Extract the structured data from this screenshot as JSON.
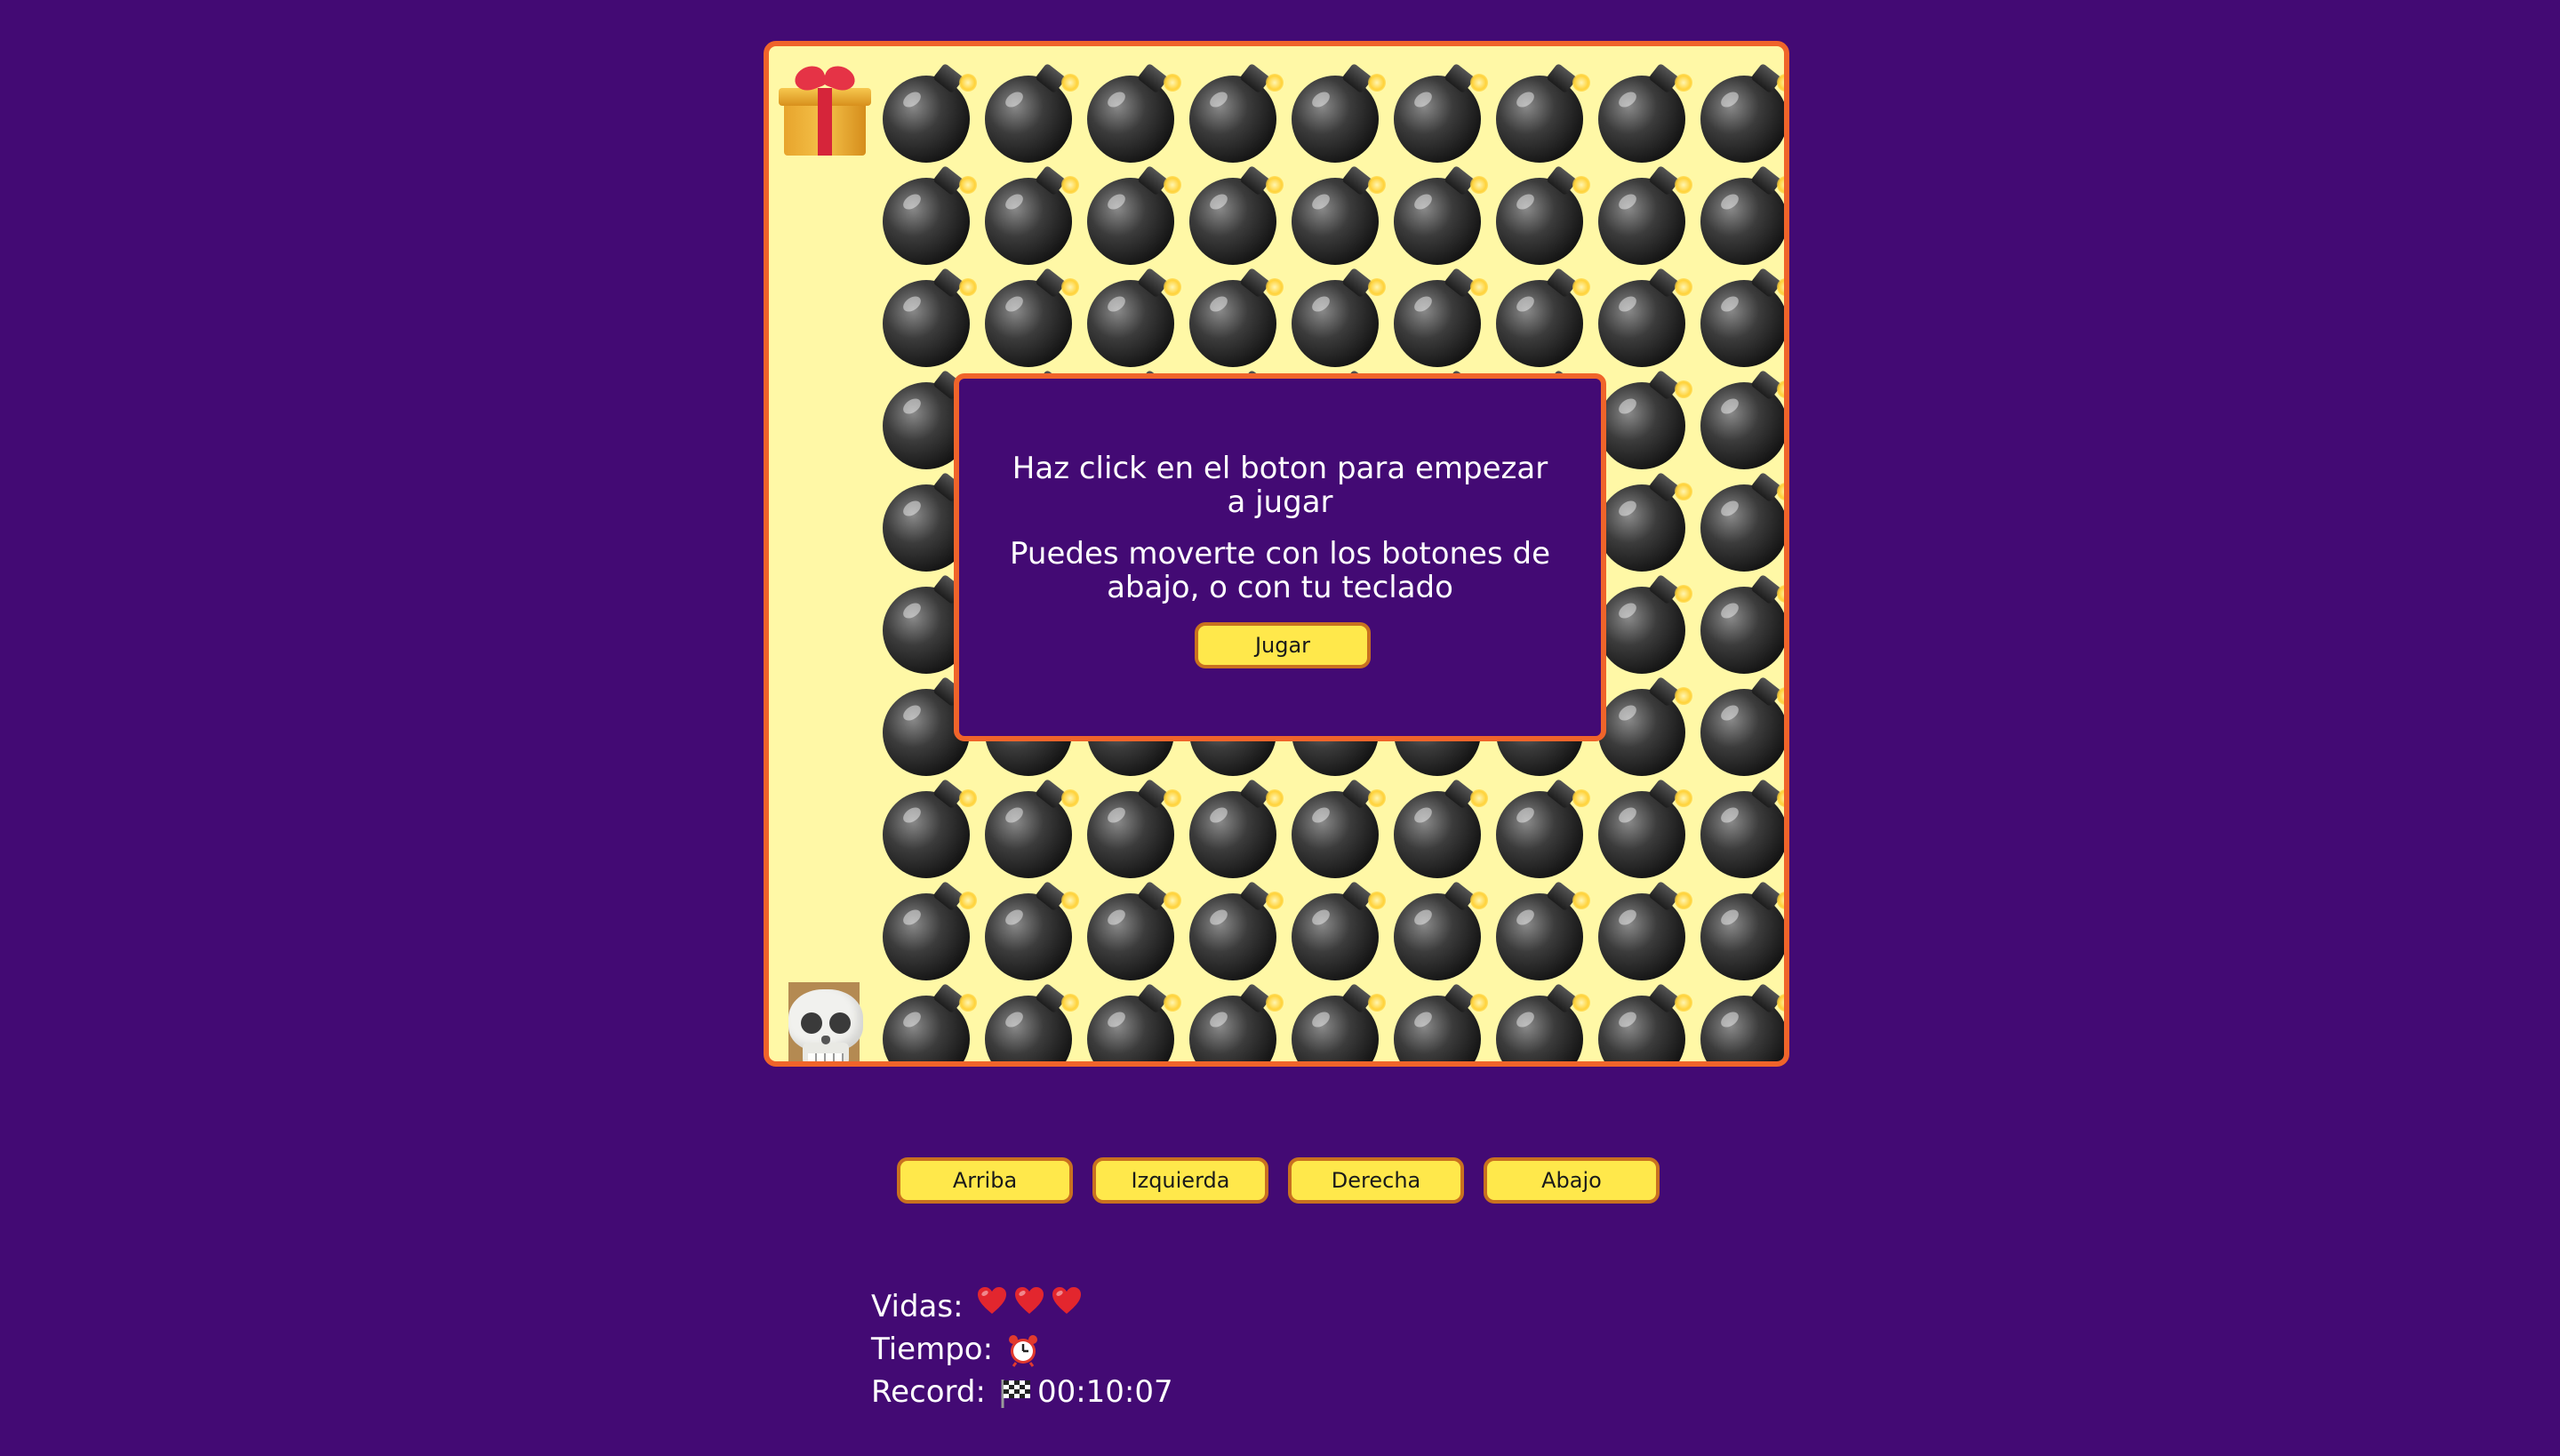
{
  "modal": {
    "line1": "Haz click en el boton para empezar a jugar",
    "line2": "Puedes moverte con los botones de abajo, o con tu teclado",
    "play_label": "Jugar"
  },
  "board": {
    "rows": 10,
    "cols": 10,
    "start_icon": "gift-icon",
    "player_icon": "skull-icon",
    "cell_icon": "bomb-icon",
    "background_color": "#fff8a6",
    "border_color": "#f0642a"
  },
  "controls": {
    "up_label": "Arriba",
    "left_label": "Izquierda",
    "right_label": "Derecha",
    "down_label": "Abajo"
  },
  "stats": {
    "lives_label": "Vidas:",
    "lives_count": 3,
    "time_label": "Tiempo:",
    "record_label": "Record:",
    "record_value": "00:10:07"
  },
  "colors": {
    "page_background": "#430a74",
    "button_fill": "#ffe84b",
    "accent": "#f0642a"
  }
}
